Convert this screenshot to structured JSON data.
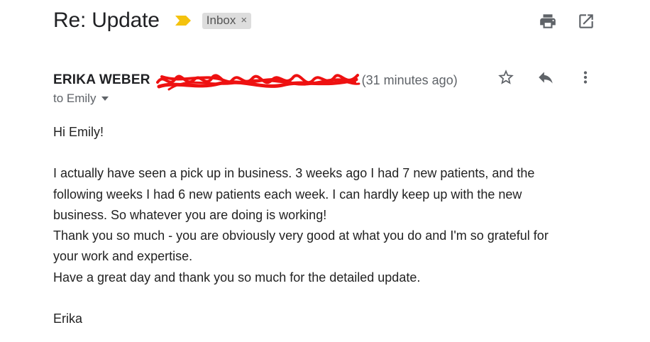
{
  "email": {
    "subject": "Re: Update",
    "label": "Inbox",
    "label_close": "×",
    "sender": "ERIKA WEBER",
    "time": "(31 minutes ago)",
    "to": "to Emily",
    "body": {
      "greeting": "Hi Emily!",
      "paragraph_lines": [
        "I actually have seen a pick up in business. 3 weeks ago I had 7 new patients, and the",
        "following weeks I had 6 new patients each week. I can hardly keep up with the new",
        "business. So whatever you are doing is working!",
        "Thank you so much - you are obviously very good at what you do and I'm so grateful for",
        "your work and expertise.",
        "Have a great day and thank you so much for the detailed update."
      ],
      "signature": "Erika"
    }
  },
  "icons": {
    "print": "print-icon",
    "open_new_window": "open-in-new-window-icon",
    "star": "star-icon",
    "reply": "reply-icon",
    "more": "more-vert-icon",
    "importance": "importance-marker-icon",
    "caret": "chevron-down-icon"
  },
  "colors": {
    "importance": "#f4c20d",
    "redaction": "#ee1111",
    "label_bg": "#dddddd",
    "icon": "#5f6368"
  }
}
